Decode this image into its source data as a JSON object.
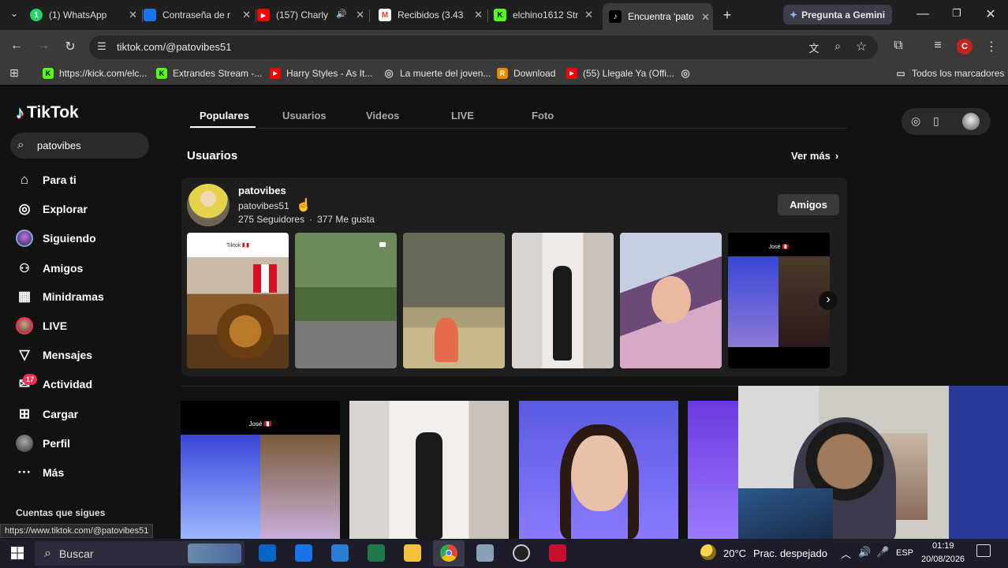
{
  "browser": {
    "tabs": [
      {
        "title": "(1) WhatsApp",
        "badge": "1",
        "color": "#25d366"
      },
      {
        "title": "Contraseña de r",
        "color": "#1a73e8"
      },
      {
        "title": "(157) Charly",
        "color": "#ff0000"
      },
      {
        "title": "Recibidos (3.43",
        "color": "#ea4335"
      },
      {
        "title": "elchino1612 Str",
        "color": "#53fc18"
      },
      {
        "title": "Encuentra 'pato",
        "color": "#000000"
      }
    ],
    "gemini_label": "Pregunta a Gemini",
    "url": "tiktok.com/@patovibes51",
    "profile_initial": "C",
    "bookmarks": [
      {
        "label": "https://kick.com/elc...",
        "color": "#53fc18",
        "glyph": "K"
      },
      {
        "label": "Extrandes Stream -...",
        "color": "#53fc18",
        "glyph": "K"
      },
      {
        "label": "Harry Styles - As It...",
        "color": "#ff0000",
        "glyph": "▶"
      },
      {
        "label": "La muerte del joven...",
        "color": "#888888",
        "glyph": "◎"
      },
      {
        "label": "Download",
        "color": "#e68a00",
        "glyph": "R"
      },
      {
        "label": "(55) Llegale Ya (Offi...",
        "color": "#ff0000",
        "glyph": "▶"
      }
    ],
    "all_bookmarks": "Todos los marcadores",
    "status_url": "https://www.tiktok.com/@patovibes51"
  },
  "tiktok": {
    "logo": "TikTok",
    "search_value": "patovibes",
    "nav": [
      {
        "label": "Para ti",
        "icon": "home-icon",
        "glyph": "⌂"
      },
      {
        "label": "Explorar",
        "icon": "compass-icon",
        "glyph": "◎"
      },
      {
        "label": "Siguiendo",
        "icon": "following-avatar-icon",
        "glyph": ""
      },
      {
        "label": "Amigos",
        "icon": "friends-icon",
        "glyph": "👥"
      },
      {
        "label": "Minidramas",
        "icon": "film-icon",
        "glyph": "▦"
      },
      {
        "label": "LIVE",
        "icon": "live-avatar-icon",
        "glyph": ""
      },
      {
        "label": "Mensajes",
        "icon": "send-icon",
        "glyph": "▽"
      },
      {
        "label": "Actividad",
        "icon": "inbox-icon",
        "glyph": "✉"
      },
      {
        "label": "Cargar",
        "icon": "upload-icon",
        "glyph": "⊞"
      },
      {
        "label": "Perfil",
        "icon": "profile-avatar-icon",
        "glyph": ""
      },
      {
        "label": "Más",
        "icon": "more-icon",
        "glyph": "···"
      }
    ],
    "activity_badge": "17",
    "following_accounts": "Cuentas que sigues",
    "tabs": [
      "Populares",
      "Usuarios",
      "Videos",
      "LIVE",
      "Foto"
    ],
    "section_title": "Usuarios",
    "see_more": "Ver más",
    "user": {
      "name": "patovibes",
      "handle": "patovibes51",
      "followers": "275 Seguidores",
      "likes": "377 Me gusta",
      "friends_button": "Amigos"
    },
    "thumb_captions": [
      "Tiktok 🇵🇪",
      "",
      "",
      "",
      "",
      "José 🇵🇪"
    ],
    "video_caption": "José 🇵🇪"
  },
  "taskbar": {
    "search_label": "Buscar",
    "temperature": "20°C",
    "weather": "Prac. despejado",
    "language": "ESP",
    "time": "01:19",
    "date": "20/08/2026"
  }
}
